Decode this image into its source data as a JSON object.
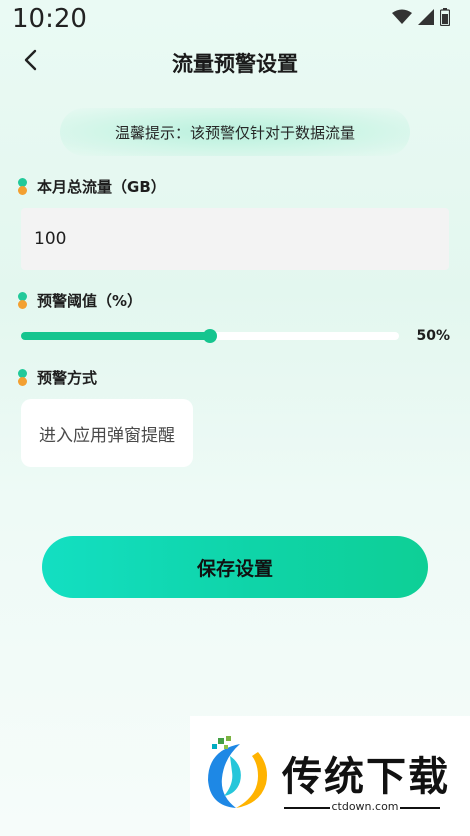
{
  "status_bar": {
    "time": "10:20",
    "icons": [
      "wifi-icon",
      "signal-icon",
      "battery-icon"
    ]
  },
  "nav": {
    "title": "流量预警设置",
    "back_icon": "chevron-left-icon"
  },
  "tip": {
    "text": "温馨提示：该预警仅针对于数据流量"
  },
  "total_flow": {
    "label": "本月总流量（GB）",
    "value": "100"
  },
  "threshold": {
    "label": "预警阈值（%）",
    "value_text": "50%",
    "percent": 50
  },
  "method": {
    "label": "预警方式",
    "option": "进入应用弹窗提醒"
  },
  "save_button": {
    "label": "保存设置"
  },
  "watermark": {
    "title": "传统下载",
    "url": "ctdown.com"
  },
  "colors": {
    "accent": "#16c58f",
    "dot_top": "#22c99a",
    "dot_bottom": "#f3a031",
    "button_start": "#13dfc2",
    "button_end": "#0ecf96"
  }
}
